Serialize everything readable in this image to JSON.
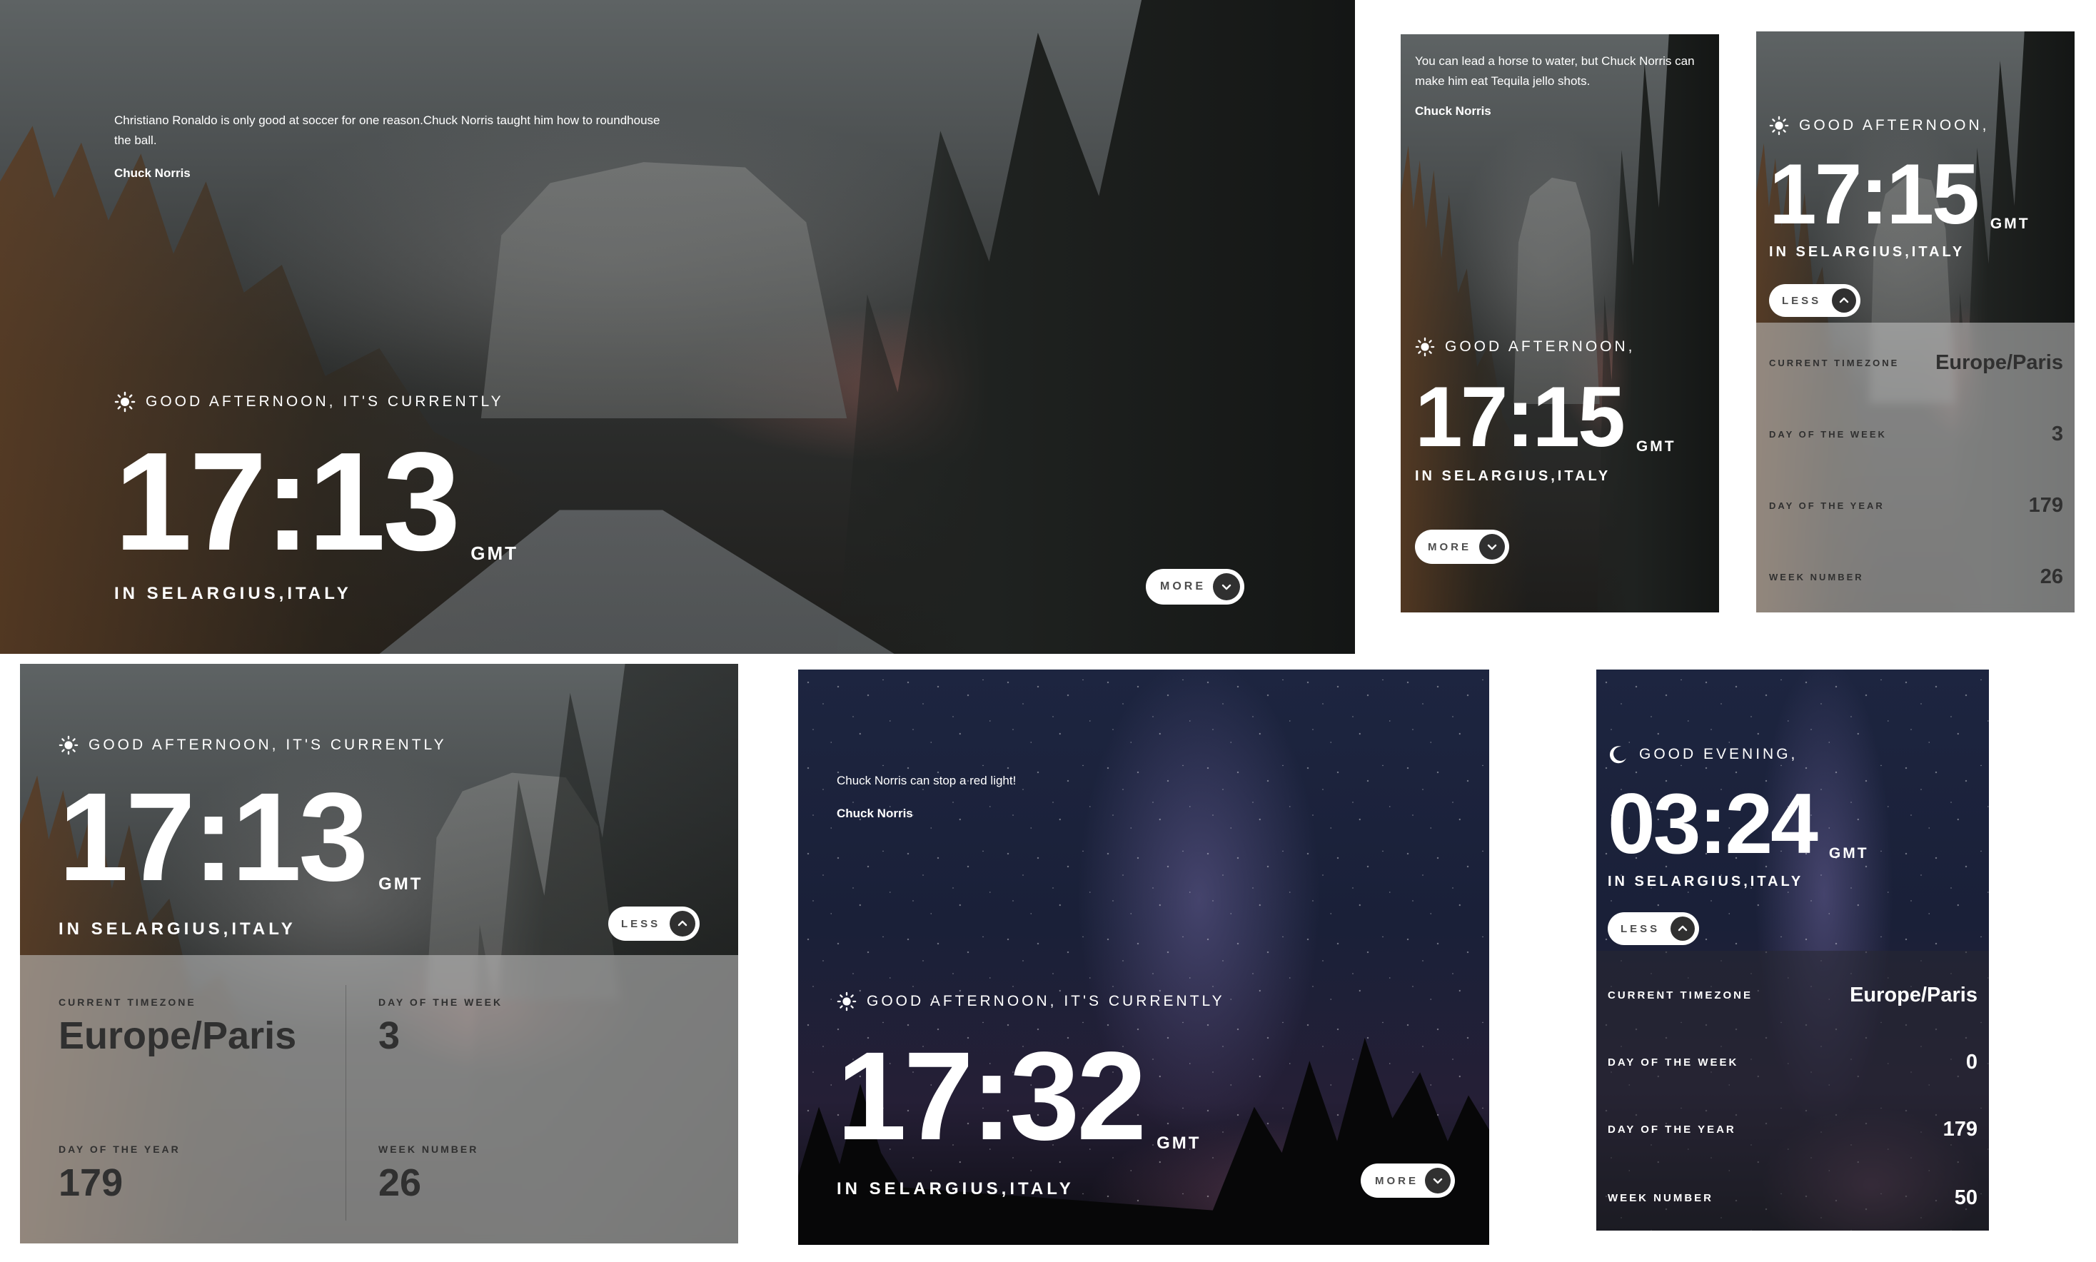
{
  "colors": {
    "button_bg": "#ffffff",
    "chevron_bg": "#303030",
    "drawer_text": "#303030"
  },
  "panel1": {
    "quote": "Christiano Ronaldo is only good at soccer for one reason.Chuck Norris taught him how to roundhouse the ball.",
    "author": "Chuck Norris",
    "greeting": "GOOD AFTERNOON, IT'S CURRENTLY",
    "time": "17:13",
    "tz": "GMT",
    "location": "IN SELARGIUS,ITALY",
    "button": "MORE"
  },
  "panel2": {
    "quote": "You can lead a horse to water, but Chuck Norris can make him eat Tequila jello shots.",
    "author": "Chuck Norris",
    "greeting": "GOOD AFTERNOON,",
    "time": "17:15",
    "tz": "GMT",
    "location": "IN SELARGIUS,ITALY",
    "button": "MORE"
  },
  "panel3": {
    "greeting": "GOOD AFTERNOON,",
    "time": "17:15",
    "tz": "GMT",
    "location": "IN SELARGIUS,ITALY",
    "button": "LESS",
    "details": [
      {
        "label": "CURRENT TIMEZONE",
        "value": "Europe/Paris"
      },
      {
        "label": "DAY OF THE WEEK",
        "value": "3"
      },
      {
        "label": "DAY OF THE YEAR",
        "value": "179"
      },
      {
        "label": "WEEK NUMBER",
        "value": "26"
      }
    ]
  },
  "panel4": {
    "greeting": "GOOD AFTERNOON, IT'S CURRENTLY",
    "time": "17:13",
    "tz": "GMT",
    "location": "IN SELARGIUS,ITALY",
    "button": "LESS",
    "details": [
      {
        "label": "CURRENT TIMEZONE",
        "value": "Europe/Paris"
      },
      {
        "label": "DAY OF THE WEEK",
        "value": "3"
      },
      {
        "label": "DAY OF THE YEAR",
        "value": "179"
      },
      {
        "label": "WEEK NUMBER",
        "value": "26"
      }
    ]
  },
  "panel5": {
    "quote": "Chuck Norris can stop a red light!",
    "author": "Chuck Norris",
    "greeting": "GOOD AFTERNOON, IT'S CURRENTLY",
    "time": "17:32",
    "tz": "GMT",
    "location": "IN SELARGIUS,ITALY",
    "button": "MORE"
  },
  "panel6": {
    "greeting": "GOOD EVENING,",
    "time": "03:24",
    "tz": "GMT",
    "location": "IN SELARGIUS,ITALY",
    "button": "LESS",
    "details": [
      {
        "label": "CURRENT TIMEZONE",
        "value": "Europe/Paris"
      },
      {
        "label": "DAY OF THE WEEK",
        "value": "0"
      },
      {
        "label": "DAY OF THE YEAR",
        "value": "179"
      },
      {
        "label": "WEEK NUMBER",
        "value": "50"
      }
    ]
  }
}
